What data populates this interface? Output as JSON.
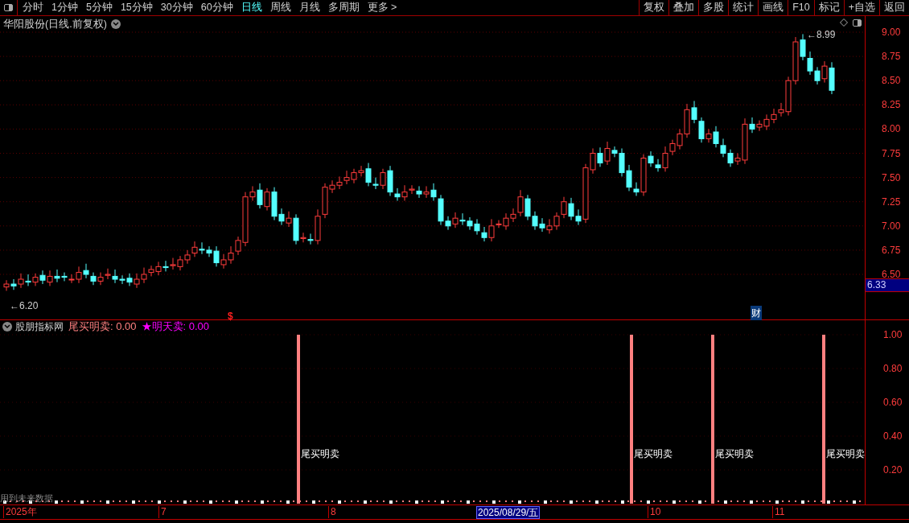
{
  "toolbar": {
    "periods": [
      {
        "label": "分时",
        "selected": false
      },
      {
        "label": "1分钟",
        "selected": false
      },
      {
        "label": "5分钟",
        "selected": false
      },
      {
        "label": "15分钟",
        "selected": false
      },
      {
        "label": "30分钟",
        "selected": false
      },
      {
        "label": "60分钟",
        "selected": false
      },
      {
        "label": "日线",
        "selected": true
      },
      {
        "label": "周线",
        "selected": false
      },
      {
        "label": "月线",
        "selected": false
      },
      {
        "label": "多周期",
        "selected": false
      },
      {
        "label": "更多 >",
        "selected": false
      }
    ],
    "actions": [
      "复权",
      "叠加",
      "多股",
      "统计",
      "画线",
      "F10",
      "标记",
      "+自选",
      "返回"
    ]
  },
  "chart": {
    "title": "华阳股份(日线.前复权)",
    "low_marker": "←6.20",
    "high_marker": "←8.99",
    "event_markers": [
      {
        "kind": "dollar",
        "label": "$"
      },
      {
        "kind": "finance",
        "label": "财"
      }
    ],
    "price_axis": [
      "9.00",
      "8.75",
      "8.50",
      "8.25",
      "8.00",
      "7.75",
      "7.50",
      "7.25",
      "7.00",
      "6.75",
      "6.50"
    ],
    "current_price": "6.33"
  },
  "indicator": {
    "name": "股朋指标网",
    "values": [
      {
        "label": "尾买明卖: 0.00",
        "color": "#ff8080"
      },
      {
        "label": "★明天卖: 0.00",
        "color": "#ff00ff"
      }
    ],
    "signals": [
      {
        "label": "尾买明卖"
      },
      {
        "label": "尾买明卖"
      },
      {
        "label": "尾买明卖"
      },
      {
        "label": "尾买明卖"
      }
    ],
    "axis": [
      "1.00",
      "0.80",
      "0.60",
      "0.40",
      "0.20"
    ],
    "note": "用到未来数据"
  },
  "time_axis": [
    {
      "label": "2025年",
      "selected": false
    },
    {
      "label": "7",
      "selected": false
    },
    {
      "label": "8",
      "selected": false
    },
    {
      "label": "2025/08/29/五",
      "selected": true
    },
    {
      "label": "10",
      "selected": false
    },
    {
      "label": "11",
      "selected": false
    }
  ]
}
